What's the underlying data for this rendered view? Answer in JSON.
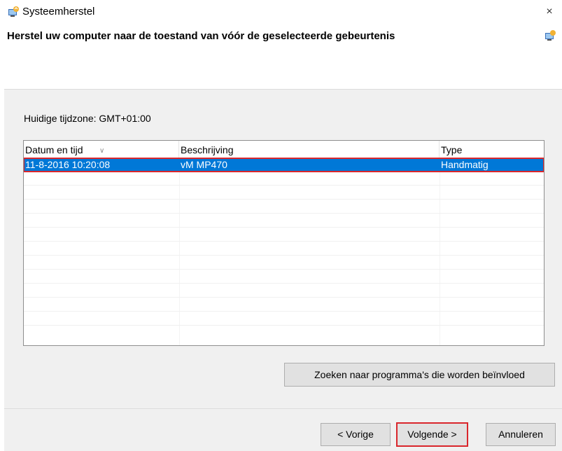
{
  "window": {
    "title": "Systeemherstel",
    "close_glyph": "×",
    "icon": "system-restore-icon"
  },
  "heading": "Herstel uw computer naar de toestand van vóór de geselecteerde gebeurtenis",
  "timezone_label": "Huidige tijdzone: GMT+01:00",
  "table": {
    "columns": [
      "Datum en tijd",
      "Beschrijving",
      "Type"
    ],
    "sort_indicator": "∨",
    "rows": [
      {
        "datetime": "11-8-2016 10:20:08",
        "description": "vM MP470",
        "type": "Handmatig",
        "selected": true
      }
    ]
  },
  "buttons": {
    "scan": "Zoeken naar programma's die worden beïnvloed",
    "back": "< Vorige",
    "next": "Volgende >",
    "cancel": "Annuleren"
  },
  "colors": {
    "selection": "#0078d7",
    "highlight_border": "#d9262c",
    "panel_bg": "#f0f0f0",
    "button_bg": "#e1e1e1"
  }
}
